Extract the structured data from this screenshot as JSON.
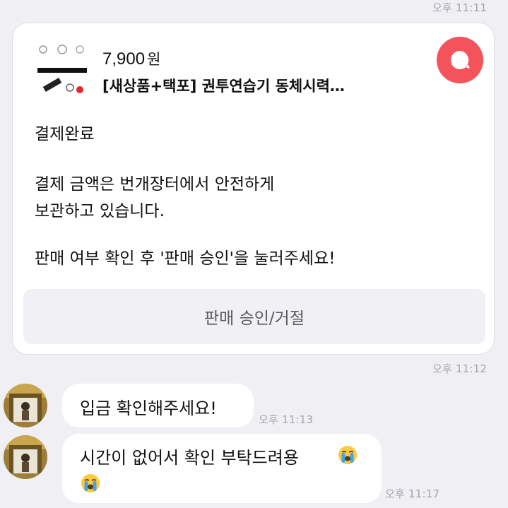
{
  "timestamps": {
    "top": "오후 11:11",
    "card": "오후 11:12",
    "msg1": "오후 11:13",
    "msg2": "오후 11:17"
  },
  "card": {
    "price": "7,900",
    "currency": "원",
    "title": "[새상품+택포] 권투연습기 동체시력…",
    "status": "결제완료",
    "body_line1": "결제 금액은 번개장터에서 안전하게",
    "body_line2": "보관하고 있습니다.",
    "body_line3": "판매 여부 확인 후 '판매 승인'을 눌러주세요!",
    "button_label": "판매 승인/거절"
  },
  "messages": [
    {
      "text": "입금 확인해주세요!"
    },
    {
      "line1": "시간이 없어서 확인 부탁드려용",
      "line2": ""
    }
  ],
  "icons": {
    "chat_badge": "chat-bubble-icon",
    "emoji": "loudly-crying-face-icon"
  },
  "colors": {
    "background": "#efeff4",
    "badge": "#f4535b",
    "bubble": "#ffffff",
    "button_bg": "#f1f1f5"
  }
}
